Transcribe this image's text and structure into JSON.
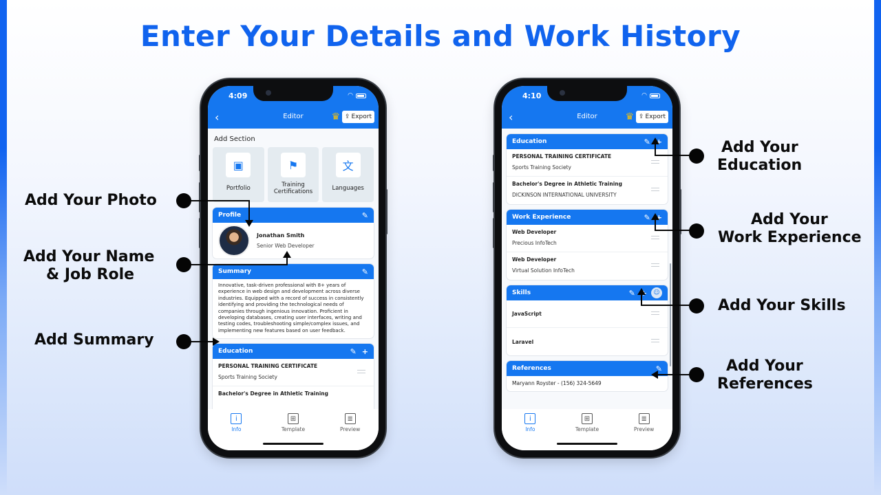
{
  "title": "Enter Your Details and Work History",
  "colors": {
    "brand": "#1063ee",
    "app_primary": "#1577f0",
    "crown": "#f4c20d"
  },
  "annotations_left": [
    {
      "id": "photo",
      "lines": [
        "Add Your Photo"
      ]
    },
    {
      "id": "name",
      "lines": [
        "Add Your Name",
        "& Job Role"
      ]
    },
    {
      "id": "summary",
      "lines": [
        "Add Summary"
      ]
    }
  ],
  "annotations_right": [
    {
      "id": "education",
      "lines": [
        "Add Your",
        "Education"
      ]
    },
    {
      "id": "work",
      "lines": [
        "Add Your",
        "Work Experience"
      ]
    },
    {
      "id": "skills",
      "lines": [
        "Add Your Skills"
      ]
    },
    {
      "id": "references",
      "lines": [
        "Add Your",
        "References"
      ]
    }
  ],
  "phone_left": {
    "time": "4:09",
    "nav": {
      "back_icon": "chevron-left",
      "title": "Editor",
      "crown_icon": "crown",
      "export_label": "Export",
      "export_icon": "share"
    },
    "add_section": {
      "heading": "Add Section",
      "tiles": [
        {
          "label": "Portfolio",
          "icon": "portfolio-icon"
        },
        {
          "label": "Training Certifications",
          "icon": "training-icon"
        },
        {
          "label": "Languages",
          "icon": "languages-icon"
        }
      ]
    },
    "profile": {
      "title": "Profile",
      "name": "Jonathan Smith",
      "role": "Senior Web Developer"
    },
    "summary": {
      "title": "Summary",
      "text": "Innovative, task-driven professional with 8+ years of experience in web design and development across diverse industries. Equipped with a record of success in consistently identifying and providing the technological needs of companies through ingenious innovation. Proficient in developing databases, creating user interfaces, writing and testing codes, troubleshooting simple/complex issues, and implementing new features based on user feedback."
    },
    "education": {
      "title": "Education",
      "items": [
        {
          "title": "PERSONAL TRAINING CERTIFICATE",
          "sub": "Sports Training Society"
        },
        {
          "title": "Bachelor's Degree in Athletic Training",
          "sub": ""
        }
      ]
    },
    "tabs": [
      {
        "label": "Info",
        "icon": "i",
        "active": true
      },
      {
        "label": "Template",
        "icon": "⊞",
        "active": false
      },
      {
        "label": "Preview",
        "icon": "≣",
        "active": false
      }
    ]
  },
  "phone_right": {
    "time": "4:10",
    "nav": {
      "title": "Editor",
      "export_label": "Export"
    },
    "education": {
      "title": "Education",
      "items": [
        {
          "title": "PERSONAL TRAINING CERTIFICATE",
          "sub": "Sports Training Society"
        },
        {
          "title": "Bachelor's Degree in Athletic Training",
          "sub": "DICKINSON INTERNATIONAL UNIVERSITY"
        }
      ]
    },
    "work": {
      "title": "Work Experience",
      "items": [
        {
          "title": "Web Developer",
          "sub": "Precious InfoTech"
        },
        {
          "title": "Web Developer",
          "sub": "Virtual Solution InfoTech"
        }
      ]
    },
    "skills": {
      "title": "Skills",
      "items": [
        "JavaScript",
        "Laravel"
      ]
    },
    "references": {
      "title": "References",
      "items": [
        "Maryann Royster - (156) 324-5649"
      ]
    },
    "tabs": [
      {
        "label": "Info",
        "icon": "i",
        "active": true
      },
      {
        "label": "Template",
        "icon": "⊞",
        "active": false
      },
      {
        "label": "Preview",
        "icon": "≣",
        "active": false
      }
    ]
  }
}
